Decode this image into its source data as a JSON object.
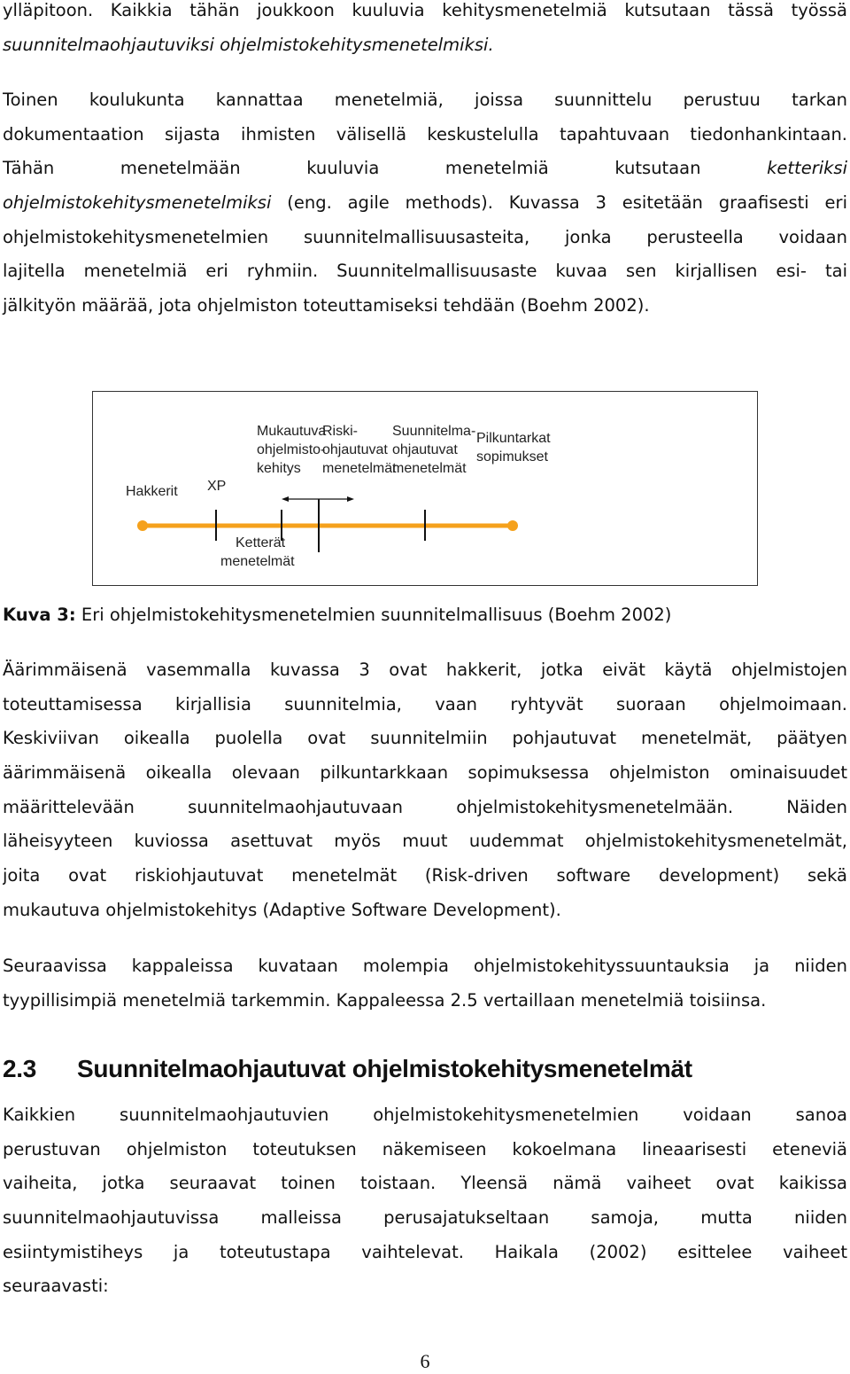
{
  "para1": {
    "lines": [
      "ylläpitoon. Kaikkia tähän joukkoon kuuluvia kehitysmenetelmiä kutsutaan tässä työssä"
    ],
    "italic_line": "suunnitelmaohjautuviksi ohjelmistokehitysmenetelmiksi."
  },
  "para2": {
    "line1": "Toinen koulukunta kannattaa menetelmiä, joissa suunnittelu perustuu tarkan",
    "line2": "dokumentaation sijasta ihmisten välisellä keskustelulla tapahtuvaan tiedonhankintaan.",
    "line3_plain": "Tähän menetelmään kuuluvia menetelmiä kutsutaan",
    "line3_italic": "ketteriksi",
    "line4_italic": "ohjelmistokehitysmenetelmiksi",
    "line4_plain": " (eng. agile methods). Kuvassa 3 esitetään graafisesti eri",
    "line5": "ohjelmistokehitysmenetelmien suunnitelmallisuusasteita, jonka perusteella voidaan",
    "line6": "lajitella menetelmiä eri ryhmiin. Suunnitelmallisuusaste kuvaa sen kirjallisen esi- tai",
    "line7": "jälkityön määrää, jota ohjelmiston toteuttamiseksi tehdään (Boehm 2002)."
  },
  "figure": {
    "line_color": "#f5a11c",
    "labels": {
      "hakkerit": "Hakkerit",
      "xp": "XP",
      "mukautuva": [
        "Mukautuva",
        "ohjelmisto-",
        "kehitys"
      ],
      "riski": [
        "Riski-",
        "ohjautuvat",
        "menetelmät"
      ],
      "suunnitelma": [
        "Suunnitelma-",
        "ohjautuvat",
        "menetelmät"
      ],
      "pilkuntarkat": [
        "Pilkuntarkat",
        "sopimukset"
      ],
      "ketterat": [
        "Ketterät",
        "menetelmät"
      ]
    }
  },
  "caption": {
    "label": "Kuva 3:",
    "text": " Eri ohjelmistokehitysmenetelmien suunnitelmallisuus (Boehm 2002)"
  },
  "para3": {
    "lines": [
      "Äärimmäisenä vasemmalla kuvassa 3 ovat hakkerit, jotka eivät käytä ohjelmistojen",
      "toteuttamisessa kirjallisia suunnitelmia, vaan ryhtyvät suoraan ohjelmoimaan.",
      "Keskiviivan oikealla puolella ovat suunnitelmiin pohjautuvat menetelmät, päätyen",
      "äärimmäisenä oikealla olevaan pilkuntarkkaan sopimuksessa ohjelmiston ominaisuudet",
      "määrittelevään suunnitelmaohjautuvaan ohjelmistokehitysmenetelmään. Näiden",
      "läheisyyteen kuviossa asettuvat myös muut uudemmat ohjelmistokehitysmenetelmät,",
      "joita ovat riskiohjautuvat menetelmät (Risk-driven software development) sekä"
    ],
    "last_line": "mukautuva ohjelmistokehitys (Adaptive Software Development)."
  },
  "para4": {
    "line1": "Seuraavissa kappaleissa kuvataan molempia ohjelmistokehityssuuntauksia ja niiden",
    "line2": "tyypillisimpiä menetelmiä tarkemmin. Kappaleessa 2.5 vertaillaan menetelmiä toisiinsa."
  },
  "heading": {
    "number": "2.3",
    "title": "Suunnitelmaohjautuvat ohjelmistokehitysmenetelmät"
  },
  "para5": {
    "lines": [
      "Kaikkien suunnitelmaohjautuvien ohjelmistokehitysmenetelmien voidaan sanoa",
      "perustuvan ohjelmiston toteutuksen näkemiseen kokoelmana lineaarisesti eteneviä",
      "vaiheita, jotka seuraavat toinen toistaan. Yleensä nämä vaiheet ovat kaikissa",
      "suunnitelmaohjautuvissa malleissa perusajatukseltaan samoja, mutta niiden",
      "esiintymistiheys ja toteutustapa vaihtelevat. Haikala (2002) esittelee vaiheet"
    ],
    "last_line": "seuraavasti:"
  },
  "page_number": "6"
}
